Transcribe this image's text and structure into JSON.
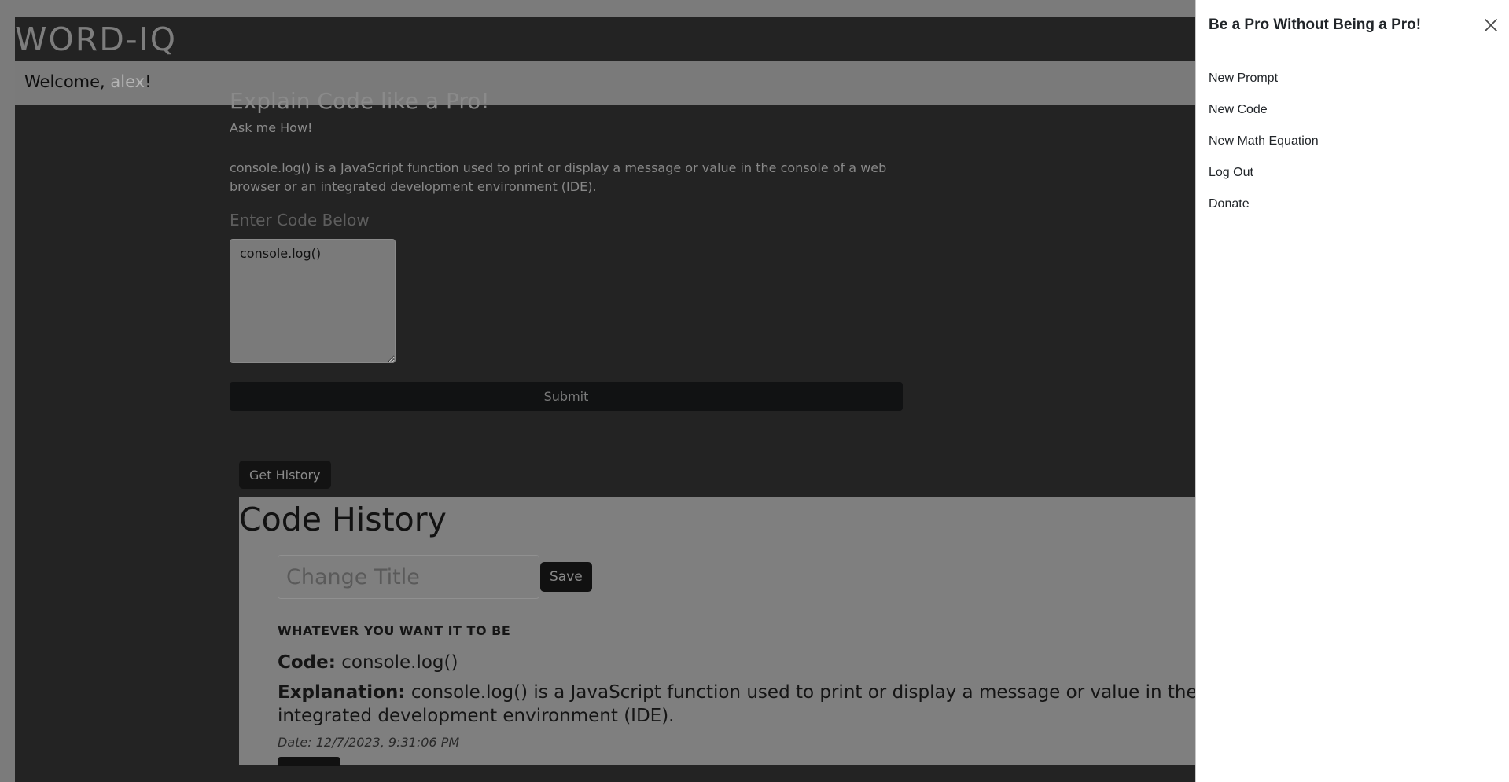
{
  "navbar": {
    "brand": "WORD-IQ"
  },
  "welcome": {
    "prefix": "Welcome, ",
    "username": "alex",
    "suffix": "!"
  },
  "main": {
    "title": "Explain Code like a Pro!",
    "subtitle": "Ask me How!",
    "answer": "console.log() is a JavaScript function used to print or display a message or value in the console of a web browser or an integrated development environment (IDE).",
    "code_label": "Enter Code Below",
    "code_value": "console.log()",
    "submit_label": "Submit"
  },
  "history": {
    "button_label": "Get History",
    "title": "Code History",
    "title_input_placeholder": "Change Title",
    "save_label": "Save",
    "entry": {
      "title": "WHATEVER YOU WANT IT TO BE",
      "code_label": "Code:",
      "code_value": "console.log()",
      "explanation_label": "Explanation:",
      "explanation_value": "console.log() is a JavaScript function used to print or display a message or value in the console of a web browser or an integrated development environment (IDE).",
      "date": "Date: 12/7/2023, 9:31:06 PM"
    }
  },
  "offcanvas": {
    "title": "Be a Pro Without Being a Pro!",
    "close_icon": "close-icon",
    "items": [
      {
        "label": "New Prompt"
      },
      {
        "label": "New Code"
      },
      {
        "label": "New Math Equation"
      },
      {
        "label": "Log Out"
      },
      {
        "label": "Donate"
      }
    ]
  }
}
